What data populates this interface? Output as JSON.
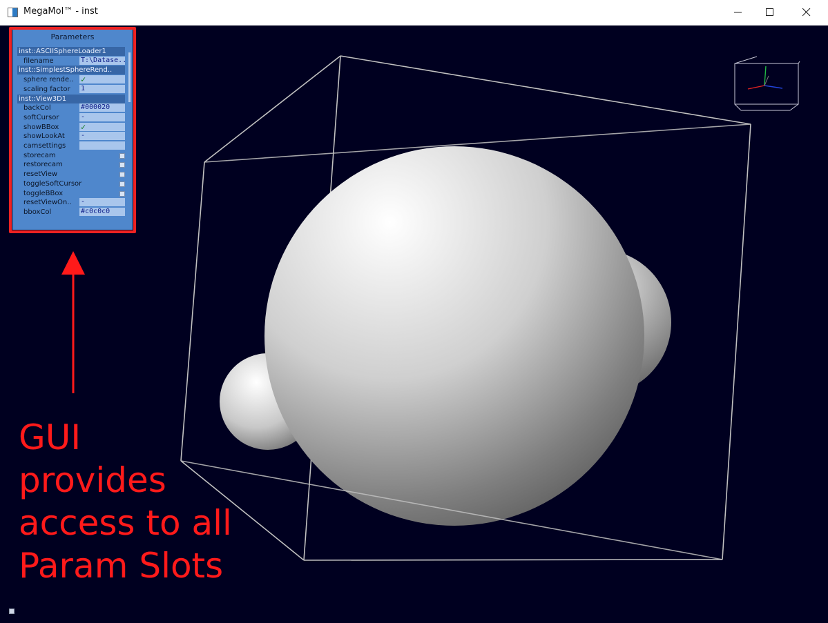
{
  "window": {
    "title": "MegaMol™ - inst"
  },
  "parameters_panel": {
    "title": "Parameters",
    "rows": [
      {
        "type": "group",
        "label": "inst::ASCIISphereLoader1"
      },
      {
        "type": "param",
        "label": "filename",
        "value": "T:\\Datase.."
      },
      {
        "type": "group",
        "label": "inst::SimplestSphereRend.."
      },
      {
        "type": "param",
        "label": "sphere rende..",
        "value": "✓"
      },
      {
        "type": "param",
        "label": "scaling factor",
        "value": "1"
      },
      {
        "type": "group",
        "label": "inst::View3D1"
      },
      {
        "type": "param",
        "label": "backCol",
        "value": "#000020"
      },
      {
        "type": "param",
        "label": "softCursor",
        "value": "-"
      },
      {
        "type": "param",
        "label": "showBBox",
        "value": "✓"
      },
      {
        "type": "param",
        "label": "showLookAt",
        "value": "-"
      },
      {
        "type": "param",
        "label": "camsettings",
        "value": ""
      },
      {
        "type": "button",
        "label": "storecam"
      },
      {
        "type": "button",
        "label": "restorecam"
      },
      {
        "type": "button",
        "label": "resetView"
      },
      {
        "type": "button",
        "label": "toggleSoftCursor"
      },
      {
        "type": "button",
        "label": "toggleBBox"
      },
      {
        "type": "param",
        "label": "resetViewOn..",
        "value": "-"
      },
      {
        "type": "param",
        "label": "bboxCol",
        "value": "#c0c0c0"
      }
    ]
  },
  "annotation": {
    "lines": [
      "GUI",
      "provides",
      "access to all",
      "Param Slots"
    ]
  },
  "colors": {
    "background": "#000020",
    "bbox": "#c0c0c0",
    "panel": "#4f87cc",
    "annotation": "#ff1a1a"
  },
  "icons": [
    "app-icon",
    "minimize-icon",
    "maximize-icon",
    "close-icon",
    "axis-gizmo-icon",
    "help-icon"
  ]
}
